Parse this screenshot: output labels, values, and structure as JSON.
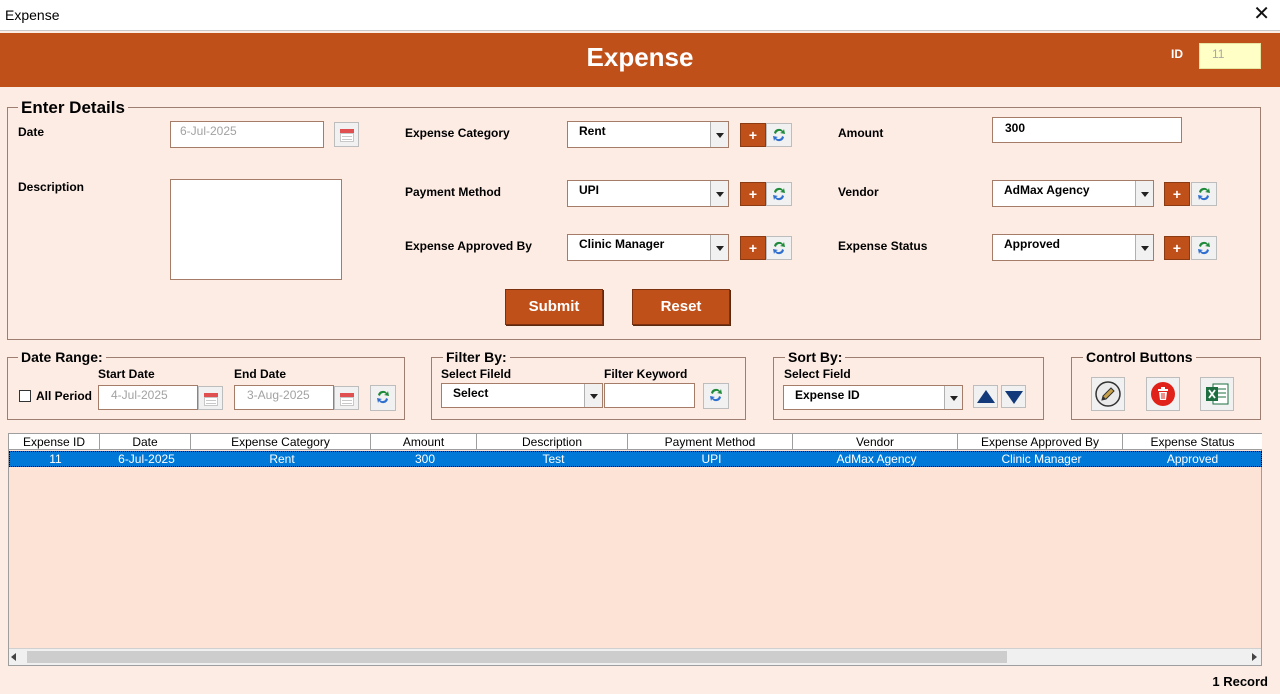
{
  "window": {
    "title": "Expense",
    "close": "✕"
  },
  "header": {
    "title": "Expense",
    "id_label": "ID",
    "id_value": "11"
  },
  "details": {
    "legend": "Enter Details",
    "date_label": "Date",
    "date_value": "6-Jul-2025",
    "description_label": "Description",
    "description_value": "",
    "category_label": "Expense Category",
    "category_value": "Rent",
    "payment_label": "Payment Method",
    "payment_value": "UPI",
    "approved_label": "Expense Approved By",
    "approved_value": "Clinic Manager",
    "amount_label": "Amount",
    "amount_value": "300",
    "vendor_label": "Vendor",
    "vendor_value": "AdMax Agency",
    "status_label": "Expense Status",
    "status_value": "Approved",
    "plus": "+",
    "submit": "Submit",
    "reset": "Reset"
  },
  "date_range": {
    "legend": "Date Range:",
    "all_period": "All Period",
    "start_label": "Start Date",
    "start_value": "4-Jul-2025",
    "end_label": "End Date",
    "end_value": "3-Aug-2025"
  },
  "filter": {
    "legend": "Filter By:",
    "field_label": "Select Fileld",
    "field_value": "Select",
    "keyword_label": "Filter Keyword",
    "keyword_value": ""
  },
  "sort": {
    "legend": "Sort By:",
    "field_label": "Select Field",
    "field_value": "Expense ID"
  },
  "controls": {
    "legend": "Control Buttons"
  },
  "table": {
    "columns": [
      "Expense ID",
      "Date",
      "Expense Category",
      "Amount",
      "Description",
      "Payment Method",
      "Vendor",
      "Expense Approved By",
      "Expense Status"
    ],
    "rows": [
      [
        "11",
        "6-Jul-2025",
        "Rent",
        "300",
        "Test",
        "UPI",
        "AdMax Agency",
        "Clinic Manager",
        "Approved"
      ]
    ]
  },
  "status_bar": {
    "record_count": "1 Record"
  },
  "colors": {
    "accent": "#c0501a",
    "background": "#fdece4",
    "selected_row": "#0078d7",
    "id_box": "#ffffc6"
  }
}
